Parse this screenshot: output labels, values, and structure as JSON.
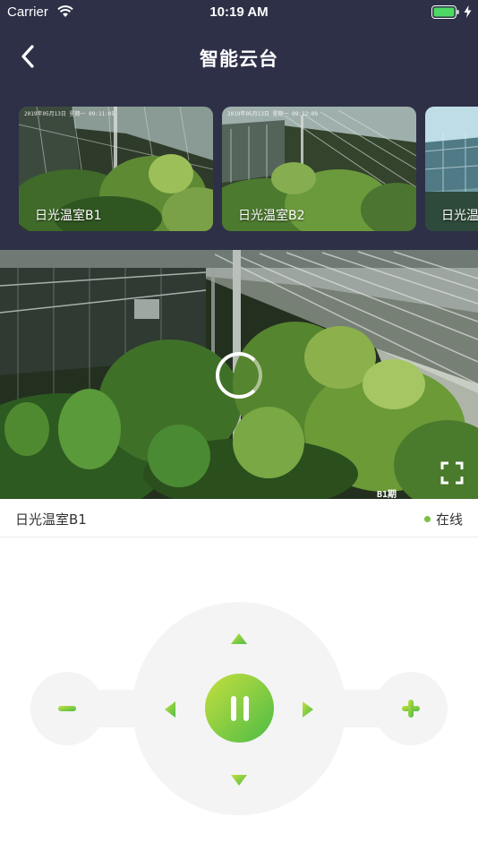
{
  "status_bar": {
    "carrier": "Carrier",
    "time": "10:19 AM"
  },
  "header": {
    "title": "智能云台"
  },
  "thumbnails": [
    {
      "label": "日光温室B1",
      "osd": "2019年05月13日 星期一 09:11:05"
    },
    {
      "label": "日光温室B2",
      "osd": "2019年05月13日 星期一 09:12:09"
    },
    {
      "label": "日光温"
    }
  ],
  "video": {
    "osd": "B1期"
  },
  "info": {
    "camera_name": "日光温室B1",
    "status": "在线"
  },
  "colors": {
    "header_bg": "#2d3047",
    "accent_green": "#7bc043",
    "gradient_start": "#c6df3f",
    "gradient_end": "#4cbc45"
  },
  "icons": [
    "back-icon",
    "wifi-icon",
    "battery-icon",
    "charge-icon",
    "loading-ring",
    "fullscreen-icon",
    "arrow-up-icon",
    "arrow-down-icon",
    "arrow-left-icon",
    "arrow-right-icon",
    "pause-icon",
    "zoom-out-icon",
    "zoom-in-icon"
  ]
}
